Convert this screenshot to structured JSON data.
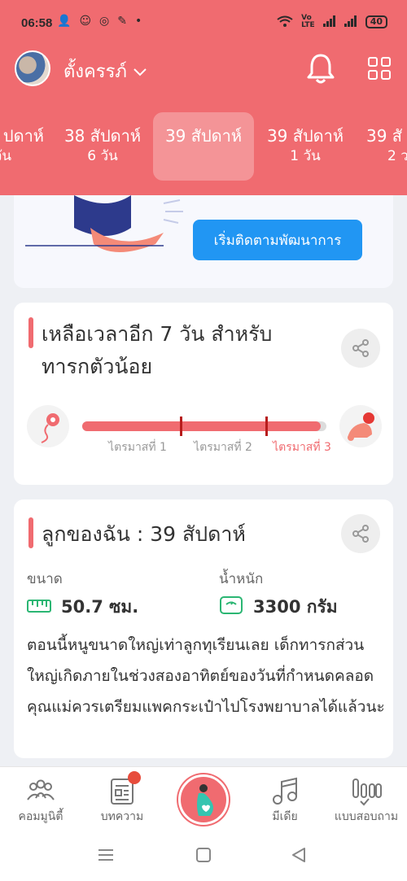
{
  "status": {
    "time": "06:58",
    "battery": "40"
  },
  "header": {
    "username": "ตั้งครรภ์"
  },
  "weeks": [
    {
      "line1": "ปดาห์",
      "line2": "วัน"
    },
    {
      "line1": "38 สัปดาห์",
      "line2": "6 วัน"
    },
    {
      "line1": "39 สัปดาห์",
      "line2": ""
    },
    {
      "line1": "39 สัปดาห์",
      "line2": "1 วัน"
    },
    {
      "line1": "39 สั",
      "line2": "2 ว"
    }
  ],
  "card1": {
    "button_label": "เริ่มติดตามพัฒนาการ"
  },
  "countdown": {
    "title_line1": "เหลือเวลาอีก 7 วัน สำหรับ",
    "title_line2": "ทารกตัวน้อย",
    "progress_fraction": 0.975,
    "trimesters": [
      "ไตรมาสที่ 1",
      "ไตรมาสที่ 2",
      "ไตรมาสที่ 3"
    ]
  },
  "baby": {
    "title": "ลูกของฉัน : 39 สัปดาห์",
    "size_label": "ขนาด",
    "size_value": "50.7 ซม.",
    "weight_label": "น้ำหนัก",
    "weight_value": "3300 กรัม",
    "description": "ตอนนี้หนูขนาดใหญ่เท่าลูกทุเรียนเลย เด็กทารกส่วนใหญ่เกิดภายในช่วงสองอาทิตย์ของวันที่กำหนดคลอด คุณแม่ควรเตรียมแพคกระเป๋าไปโรงพยาบาลได้แล้วนะ"
  },
  "nav": [
    {
      "label": "คอมมูนิตี้",
      "icon": "community-icon"
    },
    {
      "label": "บทความ",
      "icon": "article-icon"
    },
    {
      "label": "",
      "icon": "pregnancy-icon"
    },
    {
      "label": "มีเดีย",
      "icon": "music-icon"
    },
    {
      "label": "แบบสอบถาม",
      "icon": "quiz-icon"
    }
  ],
  "colors": {
    "accent": "#f06b70",
    "button": "#2196f3"
  }
}
